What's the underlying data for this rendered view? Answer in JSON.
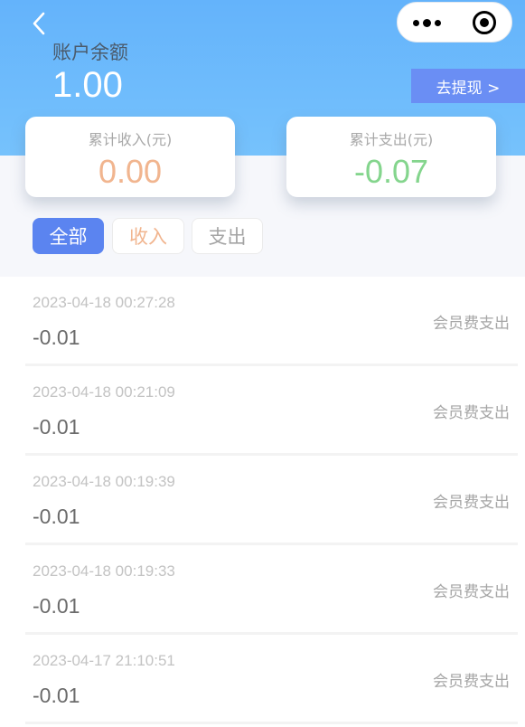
{
  "header": {
    "balance_label": "账户余额",
    "balance_value": "1.00",
    "withdraw_label": "去提现 >"
  },
  "stats": {
    "income_label": "累计收入(元)",
    "income_value": "0.00",
    "expense_label": "累计支出(元)",
    "expense_value": "-0.07"
  },
  "tabs": [
    {
      "label": "全部",
      "selected": true
    },
    {
      "label": "收入",
      "selected": false
    },
    {
      "label": "支出",
      "selected": false
    }
  ],
  "records": [
    {
      "time": "2023-04-18 00:27:28",
      "amount": "-0.01",
      "desc": "会员费支出"
    },
    {
      "time": "2023-04-18 00:21:09",
      "amount": "-0.01",
      "desc": "会员费支出"
    },
    {
      "time": "2023-04-18 00:19:39",
      "amount": "-0.01",
      "desc": "会员费支出"
    },
    {
      "time": "2023-04-18 00:19:33",
      "amount": "-0.01",
      "desc": "会员费支出"
    },
    {
      "time": "2023-04-17 21:10:51",
      "amount": "-0.01",
      "desc": "会员费支出"
    }
  ],
  "colors": {
    "header": "#6ab8fb",
    "primary": "#5b84f0",
    "income": "#f1b58f",
    "expense": "#84d58d"
  },
  "icons": {
    "back": "chevron-left-icon",
    "more": "more-dots-icon",
    "close": "target-circle-icon"
  }
}
